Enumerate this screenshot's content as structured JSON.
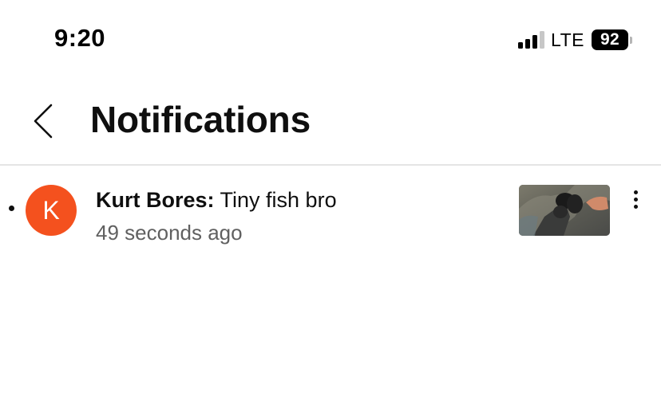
{
  "status_bar": {
    "time": "9:20",
    "network": "LTE",
    "battery": "92",
    "signal_bars_on": 3,
    "signal_bars_total": 4
  },
  "header": {
    "back_icon": "chevron-left-icon",
    "title": "Notifications"
  },
  "notifications": [
    {
      "avatar_initial": "K",
      "avatar_color": "#f4511e",
      "author": "Kurt Bores:",
      "message": "Tiny fish bro",
      "time": "49 seconds ago",
      "unread": true,
      "menu_icon": "more-vertical-icon"
    }
  ]
}
